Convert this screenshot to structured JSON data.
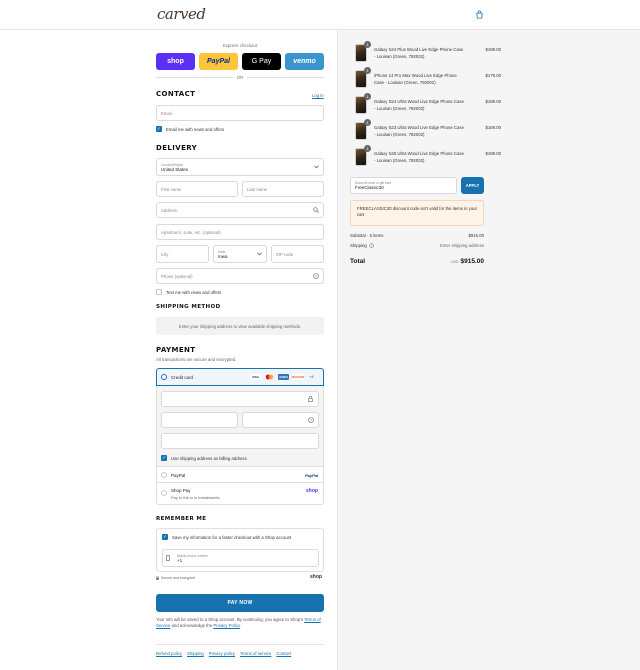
{
  "brand": {
    "logo_text": "carved"
  },
  "express": {
    "label": "Express checkout",
    "shop": "shop",
    "paypal": "PayPal",
    "gpay": "G Pay",
    "venmo": "venmo",
    "or": "OR"
  },
  "contact": {
    "title": "CONTACT",
    "login": "Log in",
    "email_placeholder": "Email",
    "news_label": "Email me with news and offers"
  },
  "delivery": {
    "title": "DELIVERY",
    "country_label": "Country/Region",
    "country_value": "United States",
    "first_name": "First name",
    "last_name": "Last name",
    "address": "Address",
    "apartment": "Apartment, suite, etc. (optional)",
    "city": "City",
    "state_label": "State",
    "state_value": "Iowa",
    "zip": "ZIP code",
    "phone": "Phone (optional)",
    "text_label": "Text me with news and offers"
  },
  "shipping": {
    "title": "SHIPPING METHOD",
    "placeholder": "Enter your shipping address to view available shipping methods."
  },
  "payment": {
    "title": "PAYMENT",
    "subtitle": "All transactions are secure and encrypted.",
    "credit_card": "Credit card",
    "cards": [
      "VISA",
      "MC",
      "AMEX",
      "DISCOVER"
    ],
    "more_cards": "+4",
    "billing_label": "Use shipping address as billing address",
    "paypal": "PayPal",
    "paypal_logo": "PayPal",
    "shop_pay": "Shop Pay",
    "shop_pay_sub": "Pay in full or in installments",
    "shop_logo": "shop"
  },
  "remember": {
    "title": "REMEMBER ME",
    "save_label": "Save my information for a faster checkout with a Shop account",
    "mobile_label": "Mobile phone number",
    "mobile_value": "+1",
    "secure": "Secure and encrypted",
    "shop_logo": "shop"
  },
  "pay_now": "PAY NOW",
  "disclaimer": {
    "text1": "Your info will be saved to a Shop account. By continuing, you agree to Shop's",
    "terms": "Terms of Service",
    "text2": "and acknowledge the",
    "privacy": "Privacy Policy",
    "end": "."
  },
  "footer": [
    "Refund policy",
    "Shipping",
    "Privacy policy",
    "Terms of service",
    "Contact"
  ],
  "order": {
    "items": [
      {
        "qty": "1",
        "name": "Galaxy S24 Plus Wood Live Edge Phone Case - Louisan (Green, 792002)",
        "price": "$189.00"
      },
      {
        "qty": "1",
        "name": "iPhone 14 Pro Max Wood Live Edge Phone Case - Louisan (Green, 792002)",
        "price": "$179.00"
      },
      {
        "qty": "1",
        "name": "Galaxy S24 Ultra Wood Live Edge Phone Case - Louisan (Green, 792002)",
        "price": "$189.00"
      },
      {
        "qty": "1",
        "name": "Galaxy S23 Ultra Wood Live Edge Phone Case - Louisan (Green, 792002)",
        "price": "$169.00"
      },
      {
        "qty": "1",
        "name": "Galaxy S25 Ultra Wood Live Edge Phone Case - Louisan (Green, 792002)",
        "price": "$189.00"
      }
    ],
    "discount_label": "Discount code or gift card",
    "discount_value": "FreeClassic30",
    "apply": "APPLY",
    "error": "FREECLASSIC30 discount code isn't valid for the items in your cart",
    "subtotal_label": "Subtotal · 5 items",
    "subtotal_value": "$915.00",
    "shipping_label": "Shipping",
    "shipping_value": "Enter shipping address",
    "total_label": "Total",
    "currency": "USD",
    "total_value": "$915.00"
  }
}
